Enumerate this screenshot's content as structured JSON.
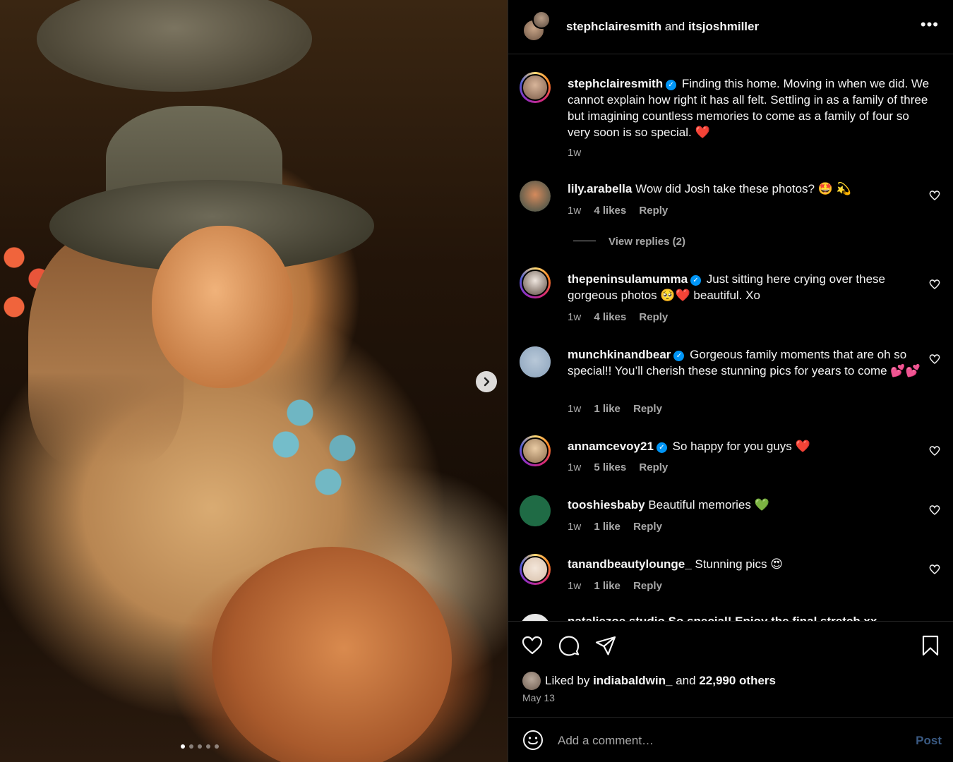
{
  "header": {
    "user1": "stephclairesmith",
    "and": "and",
    "user2": "itsjoshmiller",
    "more": "•••"
  },
  "caption": {
    "username": "stephclairesmith",
    "text": "Finding this home. Moving in when we did. We cannot explain how right it has all felt. Settling in as a family of three but imagining countless memories to come as a family of four so very soon is so special. ❤️",
    "time": "1w"
  },
  "comments": [
    {
      "username": "lily.arabella",
      "verified": false,
      "text": "Wow did Josh take these photos? 🤩 💫",
      "time": "1w",
      "likes": "4 likes",
      "reply": "Reply"
    },
    {
      "username": "thepeninsulamumma",
      "verified": true,
      "text": "Just sitting here crying over these gorgeous photos 🥺❤️ beautiful. Xo",
      "time": "1w",
      "likes": "4 likes",
      "reply": "Reply"
    },
    {
      "username": "munchkinandbear",
      "verified": true,
      "text": "Gorgeous family moments that are oh so special!! You’ll cherish these stunning pics for years to come 💕💕",
      "time": "1w",
      "likes": "1 like",
      "reply": "Reply"
    },
    {
      "username": "annamcevoy21",
      "verified": true,
      "text": "So happy for you guys ❤️",
      "time": "1w",
      "likes": "5 likes",
      "reply": "Reply"
    },
    {
      "username": "tooshiesbaby",
      "verified": false,
      "text": "Beautiful memories 💚",
      "time": "1w",
      "likes": "1 like",
      "reply": "Reply"
    },
    {
      "username": "tanandbeautylounge_",
      "verified": false,
      "text": "Stunning pics 😍",
      "time": "1w",
      "likes": "1 like",
      "reply": "Reply"
    }
  ],
  "view_replies": "View replies (2)",
  "partial_comment": "nataliezoe.studio So special! Enjoy the final stretch xx",
  "likes": {
    "prefix": "Liked by",
    "user": "indiabaldwin_",
    "middle": "and",
    "others": "22,990 others"
  },
  "date": "May 13",
  "add_comment": {
    "placeholder": "Add a comment…",
    "post": "Post"
  },
  "carousel": {
    "total": 5,
    "active": 1
  },
  "colors": {
    "accent": "#0095f6",
    "background": "#000000",
    "muted": "#a8a8a8"
  }
}
